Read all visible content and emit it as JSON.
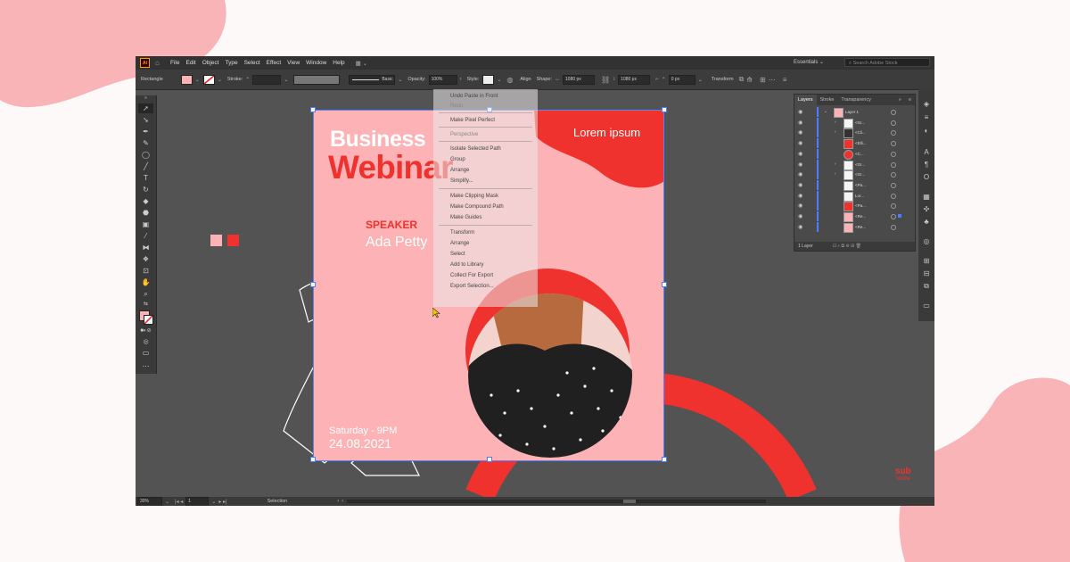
{
  "menu": {
    "app_logo": "Ai",
    "items": [
      "File",
      "Edit",
      "Object",
      "Type",
      "Select",
      "Effect",
      "View",
      "Window",
      "Help"
    ],
    "workspace": "Essentials",
    "search_placeholder": "Search Adobe Stock"
  },
  "control_bar": {
    "selection_type": "Rectangle",
    "stroke_label": "Stroke:",
    "brush_label": "Basic",
    "opacity_label": "Opacity:",
    "opacity_value": "100%",
    "style_label": "Style:",
    "align_label": "Align",
    "shape_label": "Shape:",
    "width_value": "1080 px",
    "height_value": "1080 px",
    "corner_value": "0 px",
    "transform_label": "Transform"
  },
  "context_menu": {
    "items": [
      {
        "label": "Undo Paste in Front",
        "enabled": true
      },
      {
        "label": "Redo",
        "enabled": false
      },
      {
        "label": "Make Pixel Perfect",
        "enabled": true
      },
      {
        "label": "Perspective",
        "enabled": false
      },
      {
        "label": "Isolate Selected Path",
        "enabled": true
      },
      {
        "label": "Group",
        "enabled": true
      },
      {
        "label": "Arrange",
        "enabled": true
      },
      {
        "label": "Simplify...",
        "enabled": true
      },
      {
        "label": "Make Clipping Mask",
        "enabled": true
      },
      {
        "label": "Make Compound Path",
        "enabled": true
      },
      {
        "label": "Make Guides",
        "enabled": true
      },
      {
        "label": "Transform",
        "enabled": true
      },
      {
        "label": "Arrange",
        "enabled": true
      },
      {
        "label": "Select",
        "enabled": true
      },
      {
        "label": "Add to Library",
        "enabled": true
      },
      {
        "label": "Collect For Export",
        "enabled": true
      },
      {
        "label": "Export Selection...",
        "enabled": true
      }
    ]
  },
  "artboard": {
    "title_line1": "Business",
    "title_line2": "Webinar",
    "tagline": "Lorem ipsum",
    "speaker_label": "SPEAKER",
    "speaker_name": "Ada Petty",
    "date_line1": "Saturday - 9PM",
    "date_line2": "24.08.2021"
  },
  "layers_panel": {
    "tabs": [
      "Layers",
      "Stroke",
      "Transparency"
    ],
    "rows": [
      "Layer 1",
      "<Gr...",
      "<Cli...",
      "<Elli...",
      "<C...",
      "<Gr...",
      "<Gr...",
      "<Pa...",
      "Lor...",
      "<Pa...",
      "<Re...",
      "<Re..."
    ],
    "footer": "1 Layer"
  },
  "status_bar": {
    "zoom": "30%",
    "artboard_num": "1",
    "tool": "Selection"
  },
  "branding": {
    "line1": "sub",
    "line2": "scribe"
  },
  "colors": {
    "pink": "#fdb3b5",
    "red": "#f0322e",
    "canvas": "#535353",
    "blob": "#f8b4b7"
  }
}
